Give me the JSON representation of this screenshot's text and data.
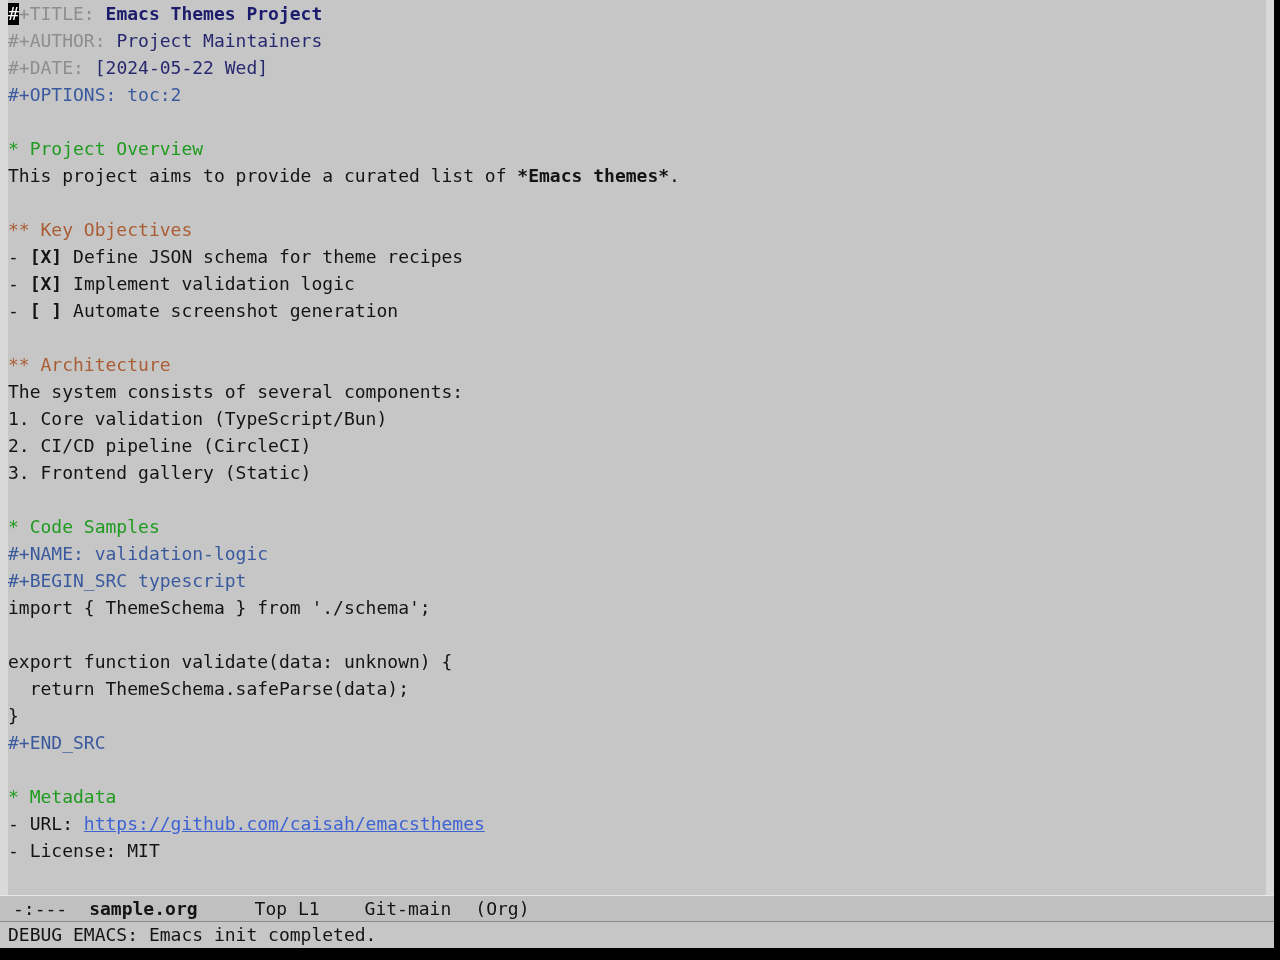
{
  "header": [
    {
      "kind": "title",
      "cursor": "#",
      "keyword": "+TITLE:",
      "value": "Emacs Themes Project"
    },
    {
      "kind": "info",
      "keyword": "#+AUTHOR:",
      "value": "Project Maintainers"
    },
    {
      "kind": "info",
      "keyword": "#+DATE:",
      "value": "[2024-05-22 Wed]"
    },
    {
      "kind": "meta",
      "text": "#+OPTIONS: toc:2"
    }
  ],
  "outline": [
    {
      "heading": "* Project Overview",
      "body": [
        {
          "kind": "paragraph",
          "segments": [
            {
              "text": "This project aims to provide a curated list of ",
              "bold": false
            },
            {
              "text": "*Emacs themes*",
              "bold": true
            },
            {
              "text": ".",
              "bold": false
            }
          ]
        }
      ],
      "children": [
        {
          "heading": "** Key Objectives",
          "body": [
            {
              "kind": "checkitem",
              "bullet": "-",
              "box": "[X]",
              "text": "Define JSON schema for theme recipes"
            },
            {
              "kind": "checkitem",
              "bullet": "-",
              "box": "[X]",
              "text": "Implement validation logic"
            },
            {
              "kind": "checkitem",
              "bullet": "-",
              "box": "[ ]",
              "text": "Automate screenshot generation"
            }
          ]
        },
        {
          "heading": "** Architecture",
          "body": [
            {
              "kind": "text",
              "text": "The system consists of several components:"
            },
            {
              "kind": "text",
              "text": "1. Core validation (TypeScript/Bun)"
            },
            {
              "kind": "text",
              "text": "2. CI/CD pipeline (CircleCI)"
            },
            {
              "kind": "text",
              "text": "3. Frontend gallery (Static)"
            }
          ]
        }
      ]
    },
    {
      "heading": "* Code Samples",
      "body": [
        {
          "kind": "meta",
          "text": "#+NAME: validation-logic"
        },
        {
          "kind": "meta",
          "text": "#+BEGIN_SRC typescript"
        },
        {
          "kind": "code",
          "paragraphs": [
            [
              "import { ThemeSchema } from './schema';"
            ],
            [
              "export function validate(data: unknown) {",
              "  return ThemeSchema.safeParse(data);",
              "}"
            ]
          ]
        },
        {
          "kind": "meta",
          "text": "#+END_SRC"
        }
      ]
    },
    {
      "heading": "* Metadata",
      "body": [
        {
          "kind": "link",
          "label": "- URL: ",
          "url": "https://github.com/caisah/emacsthemes"
        },
        {
          "kind": "text",
          "text": "- License: MIT"
        }
      ]
    }
  ],
  "mode_line": {
    "status": "-:---",
    "buffer_name": "sample.org",
    "position": "Top L1",
    "branch": "Git-main",
    "mode": "(Org)"
  },
  "echo_area": "DEBUG EMACS: Emacs init completed."
}
